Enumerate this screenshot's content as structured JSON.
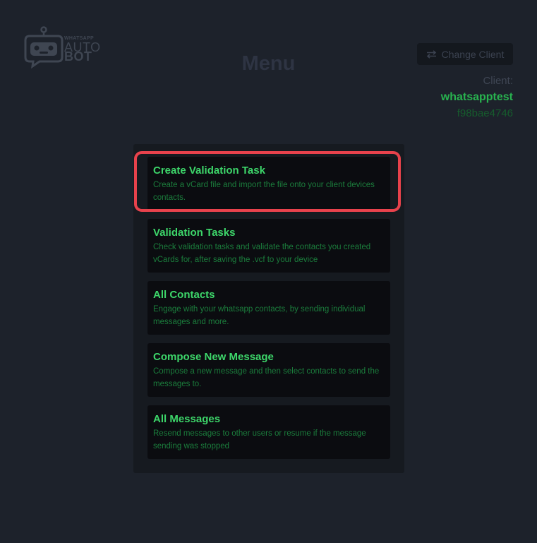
{
  "logo": {
    "small_text": "WHATSAPP",
    "line1": "AUTO",
    "line2": "BOT",
    "icon": "robot-chat-icon"
  },
  "page_title": "Menu",
  "header": {
    "change_client_label": "Change Client",
    "change_client_icon": "swap-arrows-icon"
  },
  "client": {
    "label": "Client:",
    "name": "whatsapptest",
    "id": "f98bae4746"
  },
  "menu": {
    "items": [
      {
        "title": "Create Validation Task",
        "description": "Create a vCard file and import the file onto your client devices contacts."
      },
      {
        "title": "Validation Tasks",
        "description": "Check validation tasks and validate the contacts you created vCards for, after saving the .vcf to your device"
      },
      {
        "title": "All Contacts",
        "description": "Engage with your whatsapp contacts, by sending individual messages and more."
      },
      {
        "title": "Compose New Message",
        "description": "Compose a new message and then select contacts to send the messages to."
      },
      {
        "title": "All Messages",
        "description": "Resend messages to other users or resume if the message sending was stopped"
      }
    ]
  },
  "colors": {
    "background": "#1d222b",
    "panel": "#161a20",
    "card": "#0b0c10",
    "accent_green": "#3dd66a",
    "highlight_red": "#e8424c"
  }
}
